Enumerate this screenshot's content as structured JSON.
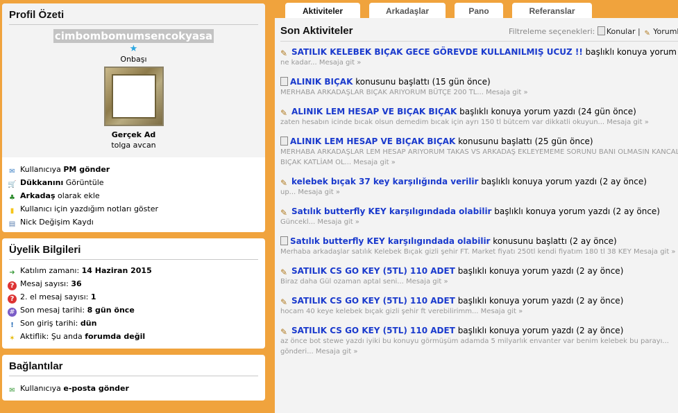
{
  "profile": {
    "title": "Profil Özeti",
    "username": "cimbombomumsencokyasa",
    "rank": "Onbaşı",
    "realname_label": "Gerçek Ad",
    "realname": "tolga avcan",
    "actions": [
      {
        "icon": "pm-icon",
        "pre": "Kullanıcıya ",
        "bold": "PM gönder",
        "post": ""
      },
      {
        "icon": "cart-icon",
        "pre": "",
        "bold": "Dükkanını",
        "post": " Görüntüle"
      },
      {
        "icon": "add-friend-icon",
        "pre": "",
        "bold": "Arkadaş",
        "post": " olarak ekle"
      },
      {
        "icon": "note-icon",
        "pre": "Kullanıcı için yazdığım notları göster",
        "bold": "",
        "post": ""
      },
      {
        "icon": "id-card-icon",
        "pre": "Nick Değişim Kaydı",
        "bold": "",
        "post": ""
      }
    ]
  },
  "membership": {
    "title": "Üyelik Bilgileri",
    "items": [
      {
        "icon": "arrow-icon",
        "label": "Katılım zamanı: ",
        "value": "14 Haziran 2015"
      },
      {
        "icon": "question-icon",
        "label": "Mesaj sayısı: ",
        "value": "36"
      },
      {
        "icon": "question-icon",
        "label": "2. el mesaj sayısı: ",
        "value": "1"
      },
      {
        "icon": "hash-icon",
        "label": "Son mesaj tarihi: ",
        "value": "8 gün önce"
      },
      {
        "icon": "warning-icon",
        "label": "Son giriş tarihi: ",
        "value": "dün"
      },
      {
        "icon": "bulb-icon",
        "label": "Aktiflik: Şu anda ",
        "value": "forumda değil"
      }
    ]
  },
  "links": {
    "title": "Bağlantılar",
    "items": [
      {
        "icon": "email-icon",
        "pre": "Kullanıcıya ",
        "bold": "e-posta gönder"
      }
    ]
  },
  "tabs": [
    "Aktiviteler",
    "Arkadaşlar",
    "Pano",
    "Referanslar"
  ],
  "main": {
    "title": "Son Aktiviteler",
    "filter_label": "Filtreleme seçenekleri:",
    "filter_options": [
      "Konular",
      "Yorumlar"
    ],
    "goto": "Mesaja git »",
    "activities": [
      {
        "type": "reply",
        "link": "SATILIK KELEBEK BIÇAK GECE GÖREVDE KULLANILMIŞ UCUZ !!",
        "text": " başlıklı konuya yorum yazdı",
        "excerpt": "ne kadar..."
      },
      {
        "type": "topic",
        "link": "ALINIK BIÇAK",
        "text": " konusunu başlattı (15 gün önce)",
        "excerpt": "MERHABA ARKADAŞLAR BIÇAK ARIYORUM BÜTÇE 200 TL..."
      },
      {
        "type": "reply",
        "link": "ALINIK LEM HESAP VE BIÇAK BIÇAK",
        "text": " başlıklı konuya yorum yazdı (24 gün önce)",
        "excerpt": "zaten hesabın icinde bıcak olsun demedim bıcak için ayrı 150 tl bütcem var dikkatli okuyun... Mesaja git »"
      },
      {
        "type": "topic",
        "link": "ALINIK LEM HESAP VE BIÇAK BIÇAK",
        "text": " konusunu başlattı (25 gün önce)",
        "excerpt": "MERHABA ARKADAŞLAR LEM HESAP ARIYORUM TAKAS VS ARKADAŞ EKLEYEMEME SORUNU BANI OLMASIN KANCALI BIÇAK KATLİAM OL..."
      },
      {
        "type": "reply",
        "link": "kelebek bıçak 37 key karşılığında verilir",
        "text": " başlıklı konuya yorum yazdı (2 ay önce)",
        "excerpt": "up..."
      },
      {
        "type": "reply",
        "link": "Satılık butterfly KEY karşılıgındada olabilir",
        "text": " başlıklı konuya yorum yazdı (2 ay önce)",
        "excerpt": "Güncekl..."
      },
      {
        "type": "topic",
        "link": "Satılık butterfly KEY karşılıgındada olabilir",
        "text": " konusunu başlattı (2 ay önce)",
        "excerpt": "Merhaba arkadaşlar satılık Kelebek Bıçak gizli şehir FT. Market fiyatı 250tl kendi fiyatım 180 tl 38 KEY"
      },
      {
        "type": "reply",
        "link": "SATILIK CS GO KEY (5TL) 110 ADET",
        "text": " başlıklı konuya yorum yazdı (2 ay önce)",
        "excerpt": "Biraz daha Gül ozaman aptal seni..."
      },
      {
        "type": "reply",
        "link": "SATILIK CS GO KEY (5TL) 110 ADET",
        "text": " başlıklı konuya yorum yazdı (2 ay önce)",
        "excerpt": "hocam 40 keye kelebek bıçak gizli şehir ft verebilirimm..."
      },
      {
        "type": "reply",
        "link": "SATILIK CS GO KEY (5TL) 110 ADET",
        "text": " başlıklı konuya yorum yazdı (2 ay önce)",
        "excerpt": "az önce bot stewe yazdı iyiki bu konuyu görmüşüm adamda 5 milyarlık envanter var benim kelebek bu parayı... gönderi..."
      }
    ]
  }
}
